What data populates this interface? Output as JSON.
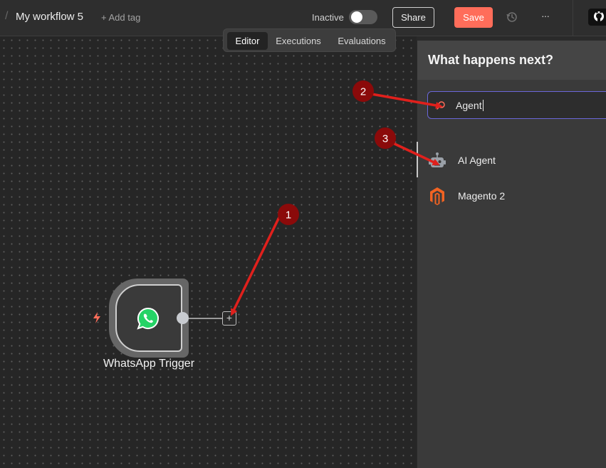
{
  "header": {
    "workflow_name": "My workflow 5",
    "add_tag_label": "+ Add tag",
    "status_label": "Inactive",
    "share_label": "Share",
    "save_label": "Save",
    "more_label": "···"
  },
  "tabs": [
    {
      "label": "Editor",
      "active": true
    },
    {
      "label": "Executions",
      "active": false
    },
    {
      "label": "Evaluations",
      "active": false
    }
  ],
  "canvas": {
    "node": {
      "label": "WhatsApp Trigger",
      "icon": "whatsapp-icon"
    },
    "add_node_label": "+"
  },
  "panel": {
    "title": "What happens next?",
    "search_value": "Agent",
    "results": [
      {
        "label": "AI Agent",
        "icon": "robot-icon"
      },
      {
        "label": "Magento 2",
        "icon": "magento-icon"
      }
    ]
  },
  "annotations": {
    "badges": [
      "1",
      "2",
      "3"
    ]
  },
  "colors": {
    "accent": "#ff6d5a",
    "search_border": "#6a67d9",
    "annotation": "#e0201c",
    "badge": "#8b0a0a"
  }
}
